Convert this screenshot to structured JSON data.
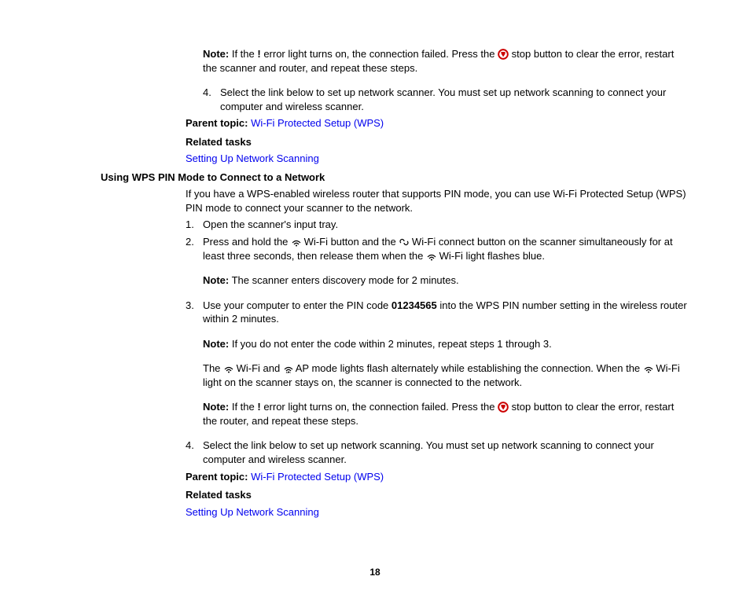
{
  "section1": {
    "note1_prefix": "Note:",
    "note1_a": " If the ",
    "note1_b": " error light turns on, the connection failed. Press the ",
    "note1_c": " stop button to clear the error, restart the scanner and router, and repeat these steps.",
    "step4_num": "4.",
    "step4_text": "Select the link below to set up network scanner. You must set up network scanning to connect your computer and wireless scanner.",
    "parent_label": "Parent topic:",
    "parent_link": "Wi-Fi Protected Setup (WPS)",
    "related_label": "Related tasks",
    "related_link": "Setting Up Network Scanning"
  },
  "heading2": "Using WPS PIN Mode to Connect to a Network",
  "section2": {
    "intro": "If you have a WPS-enabled wireless router that supports PIN mode, you can use Wi-Fi Protected Setup (WPS) PIN mode to connect your scanner to the network.",
    "step1_num": "1.",
    "step1_text": "Open the scanner's input tray.",
    "step2_num": "2.",
    "step2_a": "Press and hold the ",
    "step2_b": " Wi-Fi button and the ",
    "step2_c": " Wi-Fi connect button on the scanner simultaneously for at least three seconds, then release them when the ",
    "step2_d": " Wi-Fi light flashes blue.",
    "note2_prefix": "Note:",
    "note2_text": " The scanner enters discovery mode for 2 minutes.",
    "step3_num": "3.",
    "step3_a": "Use your computer to enter the PIN code ",
    "step3_pin": "01234565",
    "step3_b": " into the WPS PIN number setting in the wireless router within 2 minutes.",
    "note3_prefix": "Note:",
    "note3_text": " If you do not enter the code within 2 minutes, repeat steps 1 through 3.",
    "para_a": "The ",
    "para_b": " Wi-Fi and ",
    "para_c": " AP mode lights flash alternately while establishing the connection. When the ",
    "para_d": " Wi-Fi light on the scanner stays on, the scanner is connected to the network.",
    "note4_prefix": "Note:",
    "note4_a": " If the ",
    "note4_b": " error light turns on, the connection failed. Press the ",
    "note4_c": " stop button to clear the error, restart the router, and repeat these steps.",
    "step4_num": "4.",
    "step4_text": "Select the link below to set up network scanning. You must set up network scanning to connect your computer and wireless scanner.",
    "parent_label": "Parent topic:",
    "parent_link": "Wi-Fi Protected Setup (WPS)",
    "related_label": "Related tasks",
    "related_link": "Setting Up Network Scanning"
  },
  "page_number": "18"
}
